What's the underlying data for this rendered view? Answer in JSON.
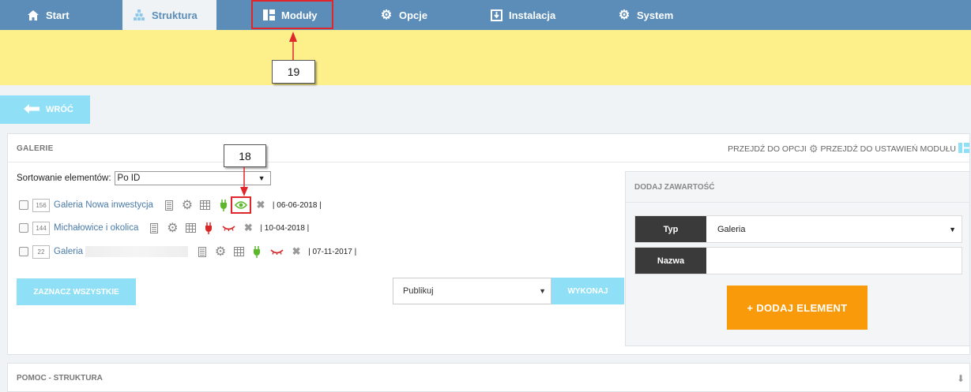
{
  "nav": {
    "items": [
      {
        "label": "Start",
        "icon": "home-icon"
      },
      {
        "label": "Struktura",
        "icon": "sitemap-icon"
      },
      {
        "label": "Moduły",
        "icon": "modules-icon"
      },
      {
        "label": "Opcje",
        "icon": "gear-icon"
      },
      {
        "label": "Instalacja",
        "icon": "install-icon"
      },
      {
        "label": "System",
        "icon": "gear-icon"
      }
    ],
    "active": "Struktura",
    "color": "#5b8db8"
  },
  "back": {
    "label": "WRÓĆ"
  },
  "panel": {
    "title": "GALERIE",
    "link_options": "PRZEJDŹ DO OPCJI",
    "link_module_settings": "PRZEJDŹ DO USTAWIEŃ MODUŁU",
    "sort_label": "Sortowanie elementów:",
    "sort_value": "Po ID",
    "rows": [
      {
        "id": "156",
        "name": "Galeria Nowa inwestycja",
        "date": "| 06-06-2018 |",
        "plug": "green",
        "visibility": "eye"
      },
      {
        "id": "144",
        "name": "Michałowice i okolica",
        "date": "| 10-04-2018 |",
        "plug": "red",
        "visibility": "closed-eye"
      },
      {
        "id": "22",
        "name": "Galeria",
        "date": "| 07-11-2017 |",
        "plug": "green",
        "visibility": "closed-eye"
      }
    ],
    "select_all_label": "ZAZNACZ WSZYSTKIE",
    "action_value": "Publikuj",
    "execute_label": "WYKONAJ"
  },
  "add": {
    "title": "DODAJ ZAWARTOŚĆ",
    "type_label": "Typ",
    "type_value": "Galeria",
    "name_label": "Nazwa",
    "name_value": "",
    "button_label": "+ DODAJ ELEMENT"
  },
  "help": {
    "title": "POMOC - STRUKTURA"
  },
  "annotations": {
    "callout_19": "19",
    "callout_18": "18"
  }
}
